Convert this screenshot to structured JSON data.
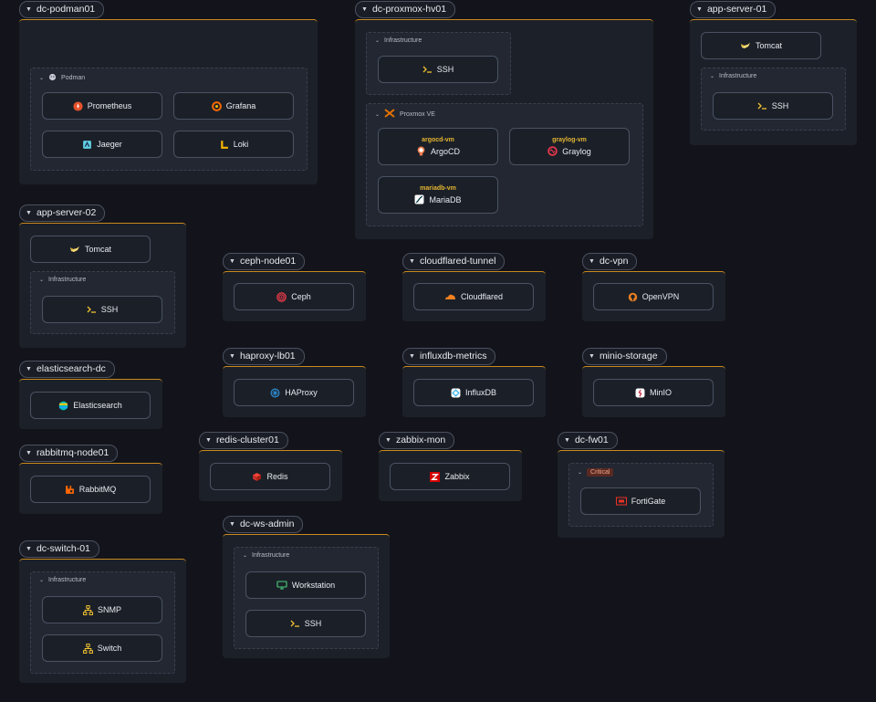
{
  "hosts": {
    "podman": {
      "name": "dc-podman01",
      "group": "Podman",
      "services": [
        "Prometheus",
        "Grafana",
        "Jaeger",
        "Loki"
      ]
    },
    "proxmox": {
      "name": "dc-proxmox-hv01",
      "group_infra": "Infrastructure",
      "ssh": "SSH",
      "group_pve": "Proxmox VE",
      "vms": [
        {
          "vm": "argocd-vm",
          "service": "ArgoCD"
        },
        {
          "vm": "graylog-vm",
          "service": "Graylog"
        },
        {
          "vm": "mariadb-vm",
          "service": "MariaDB"
        }
      ]
    },
    "app1": {
      "name": "app-server-01",
      "tomcat": "Tomcat",
      "group": "Infrastructure",
      "ssh": "SSH"
    },
    "app2": {
      "name": "app-server-02",
      "tomcat": "Tomcat",
      "group": "Infrastructure",
      "ssh": "SSH"
    },
    "ceph": {
      "name": "ceph-node01",
      "service": "Ceph"
    },
    "cloudflared": {
      "name": "cloudflared-tunnel",
      "service": "Cloudflared"
    },
    "vpn": {
      "name": "dc-vpn",
      "service": "OpenVPN"
    },
    "es": {
      "name": "elasticsearch-dc",
      "service": "Elasticsearch"
    },
    "haproxy": {
      "name": "haproxy-lb01",
      "service": "HAProxy"
    },
    "influx": {
      "name": "influxdb-metrics",
      "service": "InfluxDB"
    },
    "minio": {
      "name": "minio-storage",
      "service": "MinIO"
    },
    "rabbit": {
      "name": "rabbitmq-node01",
      "service": "RabbitMQ"
    },
    "redis": {
      "name": "redis-cluster01",
      "service": "Redis"
    },
    "zabbix": {
      "name": "zabbix-mon",
      "service": "Zabbix"
    },
    "fw": {
      "name": "dc-fw01",
      "group": "Critical",
      "service": "FortiGate"
    },
    "ws": {
      "name": "dc-ws-admin",
      "group": "Infrastructure",
      "workstation": "Workstation",
      "ssh": "SSH"
    },
    "switch": {
      "name": "dc-switch-01",
      "group": "Infrastructure",
      "services": [
        "SNMP",
        "Switch"
      ]
    }
  },
  "colors": {
    "accent": "#c98a1c",
    "vm_label": "#e5b531",
    "card_bg": "#1c2029",
    "canvas_bg": "#13141b"
  }
}
